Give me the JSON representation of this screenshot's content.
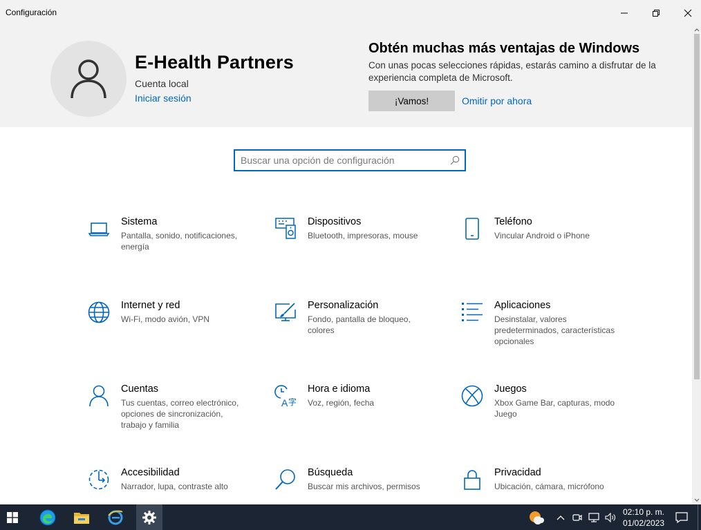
{
  "window": {
    "title": "Configuración"
  },
  "header": {
    "account_name": "E-Health Partners",
    "account_type": "Cuenta local",
    "signin_link": "Iniciar sesión",
    "promo_title": "Obtén muchas más ventajas de Windows",
    "promo_text": "Con unas pocas selecciones rápidas, estarás camino a disfrutar de la experiencia completa de Microsoft.",
    "promo_button": "¡Vamos!",
    "promo_skip": "Omitir por ahora"
  },
  "search": {
    "placeholder": "Buscar una opción de configuración",
    "value": ""
  },
  "categories": [
    {
      "name": "Sistema",
      "desc": "Pantalla, sonido, notificaciones, energía",
      "icon": "laptop-icon"
    },
    {
      "name": "Dispositivos",
      "desc": "Bluetooth, impresoras, mouse",
      "icon": "devices-icon"
    },
    {
      "name": "Teléfono",
      "desc": "Vincular Android o iPhone",
      "icon": "phone-icon"
    },
    {
      "name": "Internet y red",
      "desc": "Wi-Fi, modo avión, VPN",
      "icon": "globe-icon"
    },
    {
      "name": "Personalización",
      "desc": "Fondo, pantalla de bloqueo, colores",
      "icon": "paint-icon"
    },
    {
      "name": "Aplicaciones",
      "desc": "Desinstalar, valores predeterminados, características opcionales",
      "icon": "apps-list-icon"
    },
    {
      "name": "Cuentas",
      "desc": "Tus cuentas, correo electrónico, opciones de sincronización, trabajo y familia",
      "icon": "person-icon"
    },
    {
      "name": "Hora e idioma",
      "desc": "Voz, región, fecha",
      "icon": "time-language-icon"
    },
    {
      "name": "Juegos",
      "desc": "Xbox Game Bar, capturas, modo Juego",
      "icon": "xbox-icon"
    },
    {
      "name": "Accesibilidad",
      "desc": "Narrador, lupa, contraste alto",
      "icon": "accessibility-icon"
    },
    {
      "name": "Búsqueda",
      "desc": "Buscar mis archivos, permisos",
      "icon": "magnifier-icon"
    },
    {
      "name": "Privacidad",
      "desc": "Ubicación, cámara, micrófono",
      "icon": "lock-icon"
    }
  ],
  "taskbar": {
    "time": "02:10 p. m.",
    "date": "01/02/2023",
    "apps": [
      "start-icon",
      "edge-icon",
      "file-explorer-icon",
      "ie-icon",
      "settings-gear-icon"
    ]
  },
  "colors": {
    "accent": "#0067c0",
    "taskbar": "#1c2533",
    "banner": "#f2f2f2"
  }
}
